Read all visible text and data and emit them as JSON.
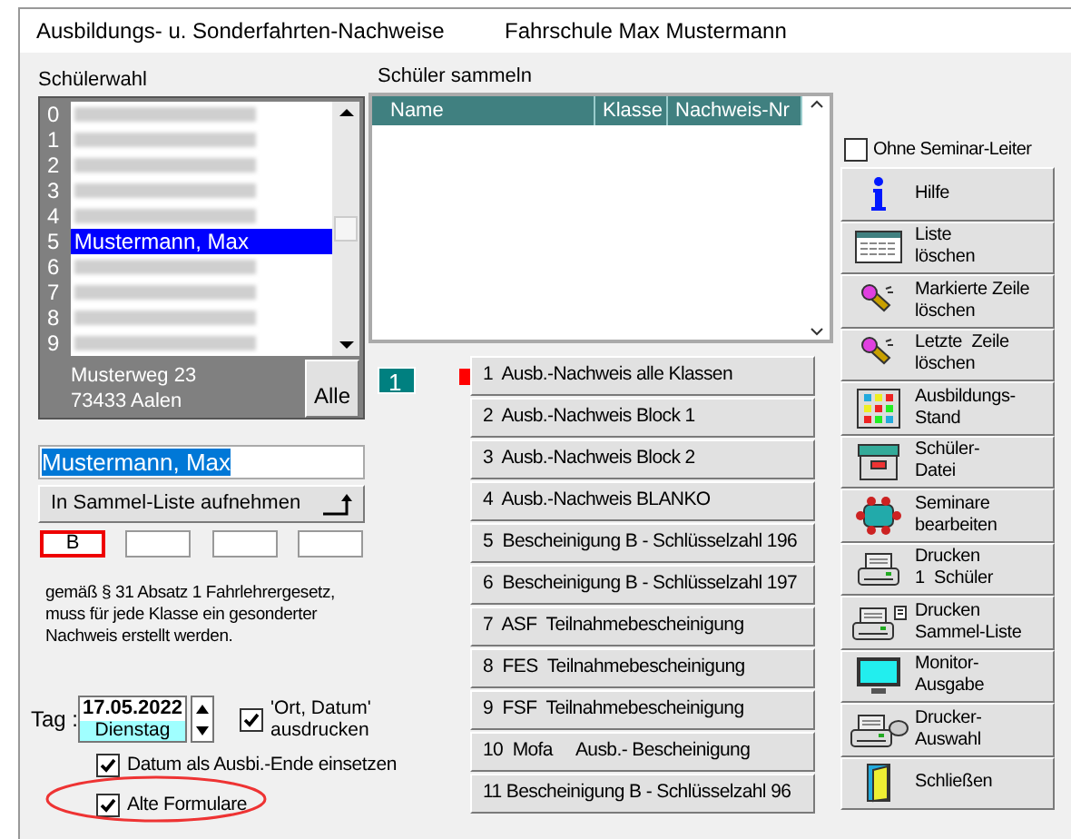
{
  "window": {
    "title": "Ausbildungs- u. Sonderfahrten-Nachweise",
    "subtitle": "Fahrschule Max Mustermann"
  },
  "student_selection": {
    "label": "Schülerwahl",
    "rows": [
      {
        "index": "0",
        "kind": "blurred",
        "selected": false
      },
      {
        "index": "1",
        "kind": "blurred",
        "selected": false
      },
      {
        "index": "2",
        "kind": "blurred",
        "selected": false
      },
      {
        "index": "3",
        "kind": "blurred",
        "selected": false
      },
      {
        "index": "4",
        "kind": "blurred",
        "selected": false
      },
      {
        "index": "5",
        "kind": "name",
        "name": "Mustermann, Max",
        "selected": true
      },
      {
        "index": "6",
        "kind": "blurred",
        "selected": false
      },
      {
        "index": "7",
        "kind": "blurred",
        "selected": false
      },
      {
        "index": "8",
        "kind": "blurred",
        "selected": false
      },
      {
        "index": "9",
        "kind": "blurred",
        "selected": false
      }
    ],
    "address": [
      "Musterweg 23",
      "73433 Aalen"
    ],
    "all_button": "Alle"
  },
  "name_field": {
    "value": "Mustermann, Max"
  },
  "add_button": "In Sammel-Liste aufnehmen",
  "class_fields": [
    {
      "value": "B",
      "selected": true
    },
    {
      "selected": false
    },
    {
      "selected": false
    },
    {
      "selected": false
    }
  ],
  "note": "gemäß § 31 Absatz 1 Fahrlehrergesetz, muss für jede Klasse ein gesonderter Nachweis erstellt werden.",
  "date": {
    "label": "Tag :",
    "value": "17.05.2022",
    "weekday": "Dienstag"
  },
  "print_place_date": {
    "label": "'Ort, Datum' ausdrucken",
    "checked": true
  },
  "options": [
    {
      "label": "Datum als Ausbi.-Ende einsetzen",
      "checked": true
    },
    {
      "label": "Alte Formulare",
      "checked": true
    }
  ],
  "collect": {
    "label": "Schüler sammeln",
    "columns": [
      "Name",
      "Klasse",
      "Nachweis-Nr"
    ]
  },
  "counter": "1",
  "forms": [
    {
      "label": "1  Ausb.-Nachweis alle Klassen",
      "selected": true
    },
    {
      "label": "2  Ausb.-Nachweis Block 1",
      "selected": false
    },
    {
      "label": "3  Ausb.-Nachweis Block 2",
      "selected": false
    },
    {
      "label": "4  Ausb.-Nachweis BLANKO",
      "selected": false
    },
    {
      "label": "5  Bescheinigung B - Schlüsselzahl 196",
      "selected": false
    },
    {
      "label": "6  Bescheinigung B - Schlüsselzahl 197",
      "selected": false
    },
    {
      "label": "7  ASF  Teilnahmebescheinigung",
      "selected": false
    },
    {
      "label": "8  FES  Teilnahmebescheinigung",
      "selected": false
    },
    {
      "label": "9  FSF  Teilnahmebescheinigung",
      "selected": false
    },
    {
      "label": "10  Mofa     Ausb.- Bescheinigung",
      "selected": false
    },
    {
      "label": "11 Bescheinigung B - Schlüsselzahl 96",
      "selected": false
    }
  ],
  "seminar_checkbox": {
    "label": "Ohne Seminar-Leiter",
    "checked": false
  },
  "actions": [
    {
      "label": "Hilfe",
      "kind": "info"
    },
    {
      "label": "Liste\nlöschen",
      "kind": "table"
    },
    {
      "label": "Markierte Zeile\nlöschen",
      "kind": "eraser"
    },
    {
      "label": "Letzte  Zeile\nlöschen",
      "kind": "eraser"
    },
    {
      "label": "Ausbildungs-\nStand",
      "kind": "grid"
    },
    {
      "label": "Schüler-\nDatei",
      "kind": "files"
    },
    {
      "label": "Seminare\nbearbeiten",
      "kind": "seminar"
    },
    {
      "label": "Drucken\n1  Schüler",
      "kind": "printer"
    },
    {
      "label": "Drucken\nSammel-Liste",
      "kind": "printerlist"
    },
    {
      "label": "Monitor-\nAusgabe",
      "kind": "monitor"
    },
    {
      "label": "Drucker-\nAuswahl",
      "kind": "printerselect"
    },
    {
      "label": "Schließen",
      "kind": "door"
    }
  ]
}
